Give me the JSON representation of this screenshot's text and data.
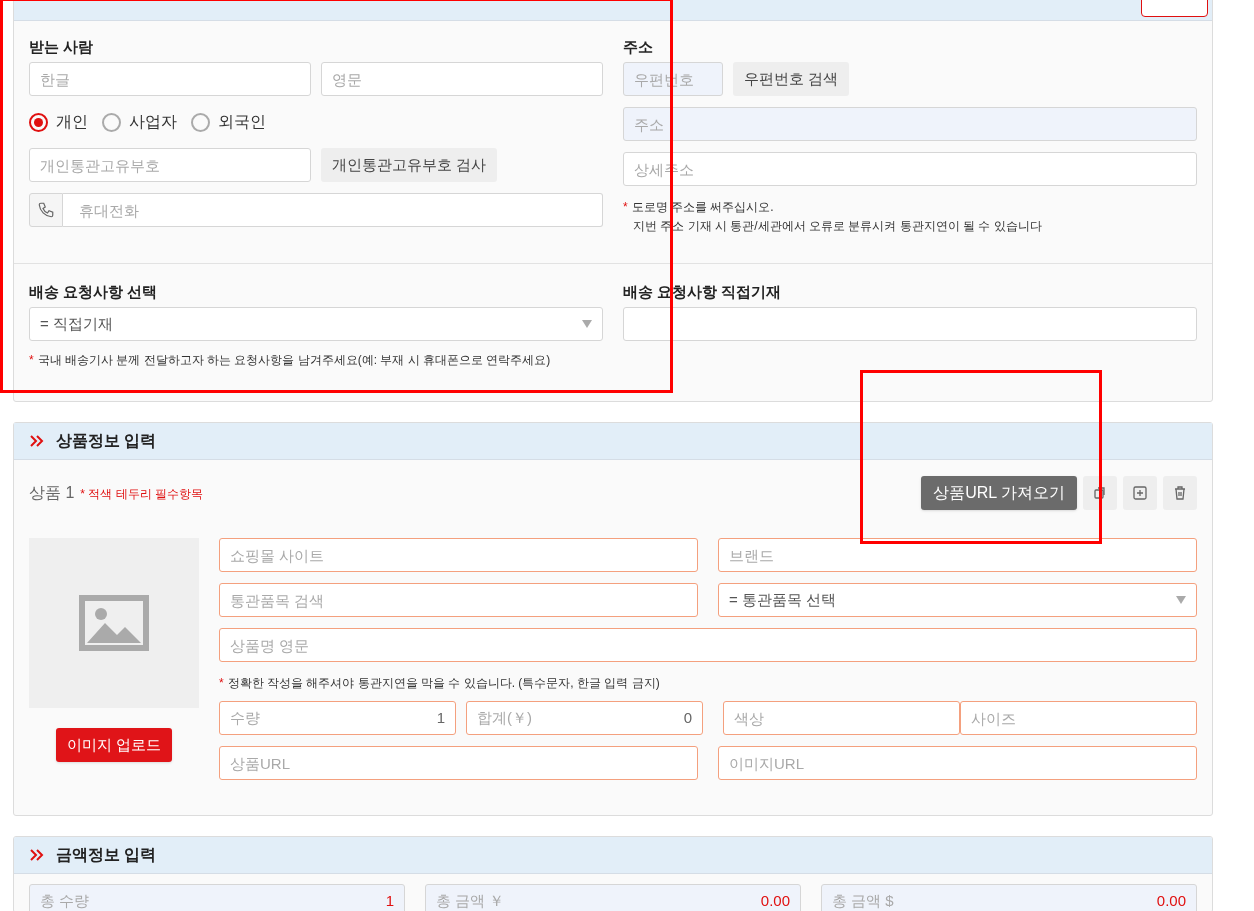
{
  "recipient": {
    "label": "받는 사람",
    "name_fields": [
      {
        "kind": "input",
        "placeholder": "한글"
      },
      {
        "kind": "input",
        "placeholder": "영문"
      }
    ],
    "types": [
      {
        "label": "개인",
        "selected": true
      },
      {
        "label": "사업자",
        "selected": false
      },
      {
        "label": "외국인",
        "selected": false
      }
    ],
    "customs_field": {
      "kind": "input",
      "placeholder": "개인통관고유부호"
    },
    "customs_button": "개인통관고유부호 검사",
    "phone_field": {
      "kind": "phone",
      "placeholder": "휴대전화"
    }
  },
  "address": {
    "label": "주소",
    "zip_field": {
      "kind": "input",
      "placeholder": "우편번호",
      "disabled": true
    },
    "zip_button": "우편번호 검색",
    "address_field": {
      "kind": "input",
      "placeholder": "주소",
      "disabled": true
    },
    "detail_field": {
      "kind": "input",
      "placeholder": "상세주소",
      "disabled": false
    },
    "note_marker": "*",
    "note_lines": [
      "도로명 주소를 써주십시오.",
      "지번 주소 기재 시 통관/세관에서 오류로 분류시켜 통관지연이 될 수 있습니다"
    ]
  },
  "delivery": {
    "select_label": "배송 요청사항 선택",
    "select_field": {
      "kind": "select",
      "value": "= 직접기재"
    },
    "note_marker": "*",
    "note": "국내 배송기사 분께 전달하고자 하는 요청사항을 남겨주세요(예: 부재 시 휴대폰으로 연락주세요)",
    "direct_label": "배송 요청사항 직접기재",
    "direct_field": {
      "kind": "input"
    }
  },
  "product_section": {
    "title": "상품정보 입력",
    "product_label": "상품 1",
    "required_note": "* 적색 테두리 필수항목",
    "url_button": "상품URL 가져오기",
    "upload_button": "이미지 업로드",
    "fields_top": [
      {
        "kind": "input",
        "placeholder": "쇼핑몰 사이트",
        "required": true
      },
      {
        "kind": "input",
        "placeholder": "브랜드",
        "required": true
      },
      {
        "kind": "input",
        "placeholder": "통관품목 검색",
        "required": true
      },
      {
        "kind": "select",
        "value": "= 통관품목 선택",
        "required": true
      }
    ],
    "name_field": {
      "kind": "input",
      "placeholder": "상품명 영문",
      "required": true
    },
    "note_marker": "*",
    "note": "정확한 작성을 해주셔야 통관지연을 막을 수 있습니다. (특수문자, 한글 입력 금지)",
    "fields_bottom": [
      {
        "kind": "number",
        "placeholder": "수량",
        "value": "1",
        "required": true
      },
      {
        "kind": "number",
        "placeholder": "합계(￥)",
        "value": "0",
        "required": true
      },
      {
        "kind": "input",
        "placeholder": "색상",
        "required": true
      },
      {
        "kind": "input",
        "placeholder": "사이즈",
        "required": true
      }
    ],
    "url_fields": [
      {
        "kind": "input",
        "placeholder": "상품URL",
        "required": true
      },
      {
        "kind": "input",
        "placeholder": "이미지URL",
        "required": true
      }
    ]
  },
  "amount_section": {
    "title": "금액정보 입력",
    "fields": [
      {
        "kind": "total",
        "placeholder": "총 수량",
        "value": "1",
        "disabled": true
      },
      {
        "kind": "total",
        "placeholder": "총 금액 ￥",
        "value": "0.00",
        "disabled": true
      },
      {
        "kind": "total",
        "placeholder": "총 금액 $",
        "value": "0.00",
        "disabled": true
      }
    ]
  }
}
